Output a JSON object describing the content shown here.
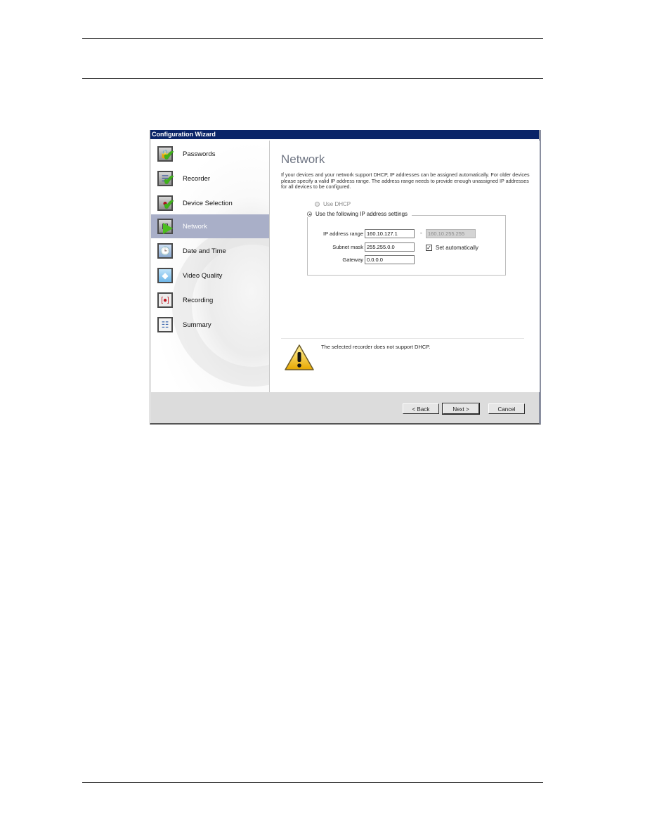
{
  "window": {
    "title": "Configuration Wizard"
  },
  "sidebar": {
    "items": [
      {
        "label": "Passwords",
        "icon": "lock-icon",
        "status": "complete"
      },
      {
        "label": "Recorder",
        "icon": "recorder-icon",
        "status": "complete"
      },
      {
        "label": "Device Selection",
        "icon": "device-icon",
        "status": "complete"
      },
      {
        "label": "Network",
        "icon": "network-icon",
        "status": "current"
      },
      {
        "label": "Date and Time",
        "icon": "clock-icon",
        "status": "pending"
      },
      {
        "label": "Video Quality",
        "icon": "diamond-icon",
        "status": "pending"
      },
      {
        "label": "Recording",
        "icon": "record-icon",
        "status": "pending"
      },
      {
        "label": "Summary",
        "icon": "summary-icon",
        "status": "pending"
      }
    ]
  },
  "main": {
    "title": "Network",
    "intro": "If your devices and your network support DHCP, IP addresses can be assigned automatically. For older devices please specify a valid IP address range. The address range needs to provide enough unassigned IP addresses for all devices to be configured.",
    "options": {
      "use_dhcp": {
        "label": "Use DHCP",
        "checked": false,
        "enabled": false
      },
      "use_static": {
        "label": "Use the following IP address settings",
        "checked": true,
        "enabled": true
      }
    },
    "fields": {
      "ip_range_label": "IP address range",
      "ip_range_start": "160.10.127.1",
      "range_separator": "-",
      "ip_range_end": "160.10.255.255",
      "subnet_label": "Subnet mask",
      "subnet_value": "255.255.0.0",
      "set_auto_label": "Set automatically",
      "set_auto_checked": true,
      "gateway_label": "Gateway",
      "gateway_value": "0.0.0.0"
    },
    "warning": "The selected recorder does not support DHCP."
  },
  "buttons": {
    "back": "< Back",
    "next": "Next >",
    "cancel": "Cancel"
  }
}
